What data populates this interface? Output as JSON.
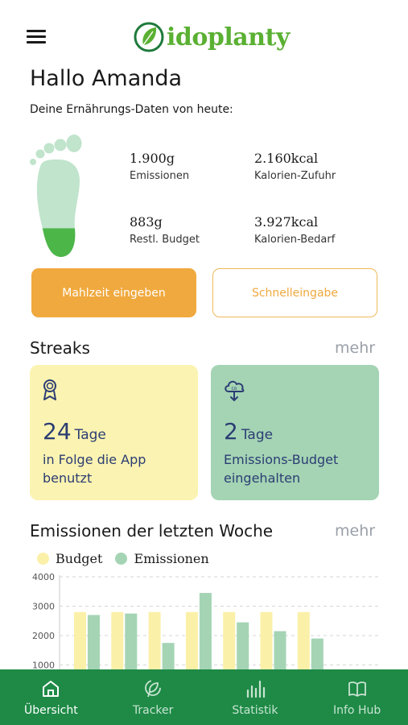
{
  "header": {
    "logo_text": "idoplanty"
  },
  "greeting": "Hallo Amanda",
  "subtitle": "Deine Ernährungs-Daten von heute:",
  "stats": [
    {
      "value": "1.900g",
      "label": "Emissionen"
    },
    {
      "value": "2.160kcal",
      "label": "Kalorien-Zufuhr"
    },
    {
      "value": "883g",
      "label": "Restl. Budget"
    },
    {
      "value": "3.927kcal",
      "label": "Kalorien-Bedarf"
    }
  ],
  "footprint_fill_fraction": 0.3,
  "buttons": {
    "primary": "Mahlzeit eingeben",
    "secondary": "Schnelleingabe"
  },
  "streaks": {
    "title": "Streaks",
    "more": "mehr",
    "cards": [
      {
        "number": "24",
        "unit": "Tage",
        "desc_line1": "in Folge die App",
        "desc_line2": "benutzt",
        "icon": "award-ribbon-icon"
      },
      {
        "number": "2",
        "unit": "Tage",
        "desc_line1": "Emissions-Budget",
        "desc_line2": "eingehalten",
        "icon": "cloud-co2-down-icon"
      }
    ]
  },
  "emissions_section": {
    "title": "Emissionen der letzten Woche",
    "more": "mehr"
  },
  "colors": {
    "accent_orange": "#f0a93e",
    "brand_green": "#1e8a46",
    "budget_yellow": "#fbf0a8",
    "emission_green": "#a4d4b4"
  },
  "chart_data": {
    "type": "bar",
    "legend": [
      "Budget",
      "Emissionen"
    ],
    "y_ticks": [
      "4000",
      "3000",
      "2000",
      "1000"
    ],
    "ylim": [
      0,
      4000
    ],
    "grid": true,
    "series": [
      {
        "name": "Budget",
        "values": [
          2800,
          2800,
          2800,
          2800,
          2800,
          2800,
          2800
        ]
      },
      {
        "name": "Emissionen",
        "values": [
          2700,
          2750,
          1750,
          3450,
          2450,
          2150,
          1900
        ]
      }
    ]
  },
  "tabbar": [
    {
      "label": "Übersicht",
      "icon": "home-icon",
      "active": true
    },
    {
      "label": "Tracker",
      "icon": "leaf-tracker-icon",
      "active": false
    },
    {
      "label": "Statistik",
      "icon": "bar-chart-icon",
      "active": false
    },
    {
      "label": "Info Hub",
      "icon": "book-icon",
      "active": false
    }
  ]
}
